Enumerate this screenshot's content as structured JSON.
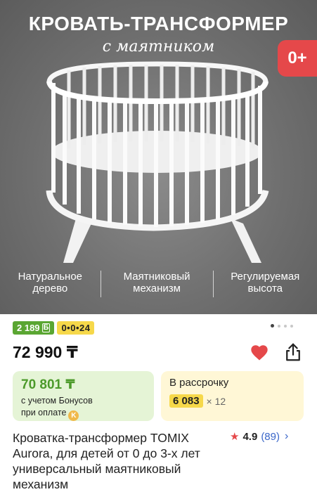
{
  "hero": {
    "title": "КРОВАТЬ-ТРАНСФОРМЕР",
    "subtitle": "с маятником",
    "age_badge": "0+",
    "features": [
      "Натуральное дерево",
      "Маятниковый механизм",
      "Регулируемая высота"
    ]
  },
  "gallery": {
    "total_images": 4,
    "active_index": 0
  },
  "badges": {
    "bonus": "2 189",
    "bonus_icon": "Б",
    "installment_plan": "0•0•24"
  },
  "price": {
    "value": "72 990 ₸"
  },
  "bonus_card": {
    "amount": "70 801 ₸",
    "note_line1": "с учетом Бонусов",
    "note_line2": "при оплате",
    "coin_icon": "kaspi-coin-icon"
  },
  "installment_card": {
    "label": "В рассрочку",
    "amount": "6 083",
    "multiplier": "× 12"
  },
  "product": {
    "title": "Кроватка-трансформер TOMIX Aurora, для детей от 0 до 3-х лет универсальный маятниковый механизм"
  },
  "rating": {
    "value": "4.9",
    "count": "(89)"
  },
  "colors": {
    "accent_red": "#e5484a",
    "bonus_green": "#5aa632",
    "highlight_yellow": "#f6d84a",
    "link_blue": "#3b67c9"
  }
}
